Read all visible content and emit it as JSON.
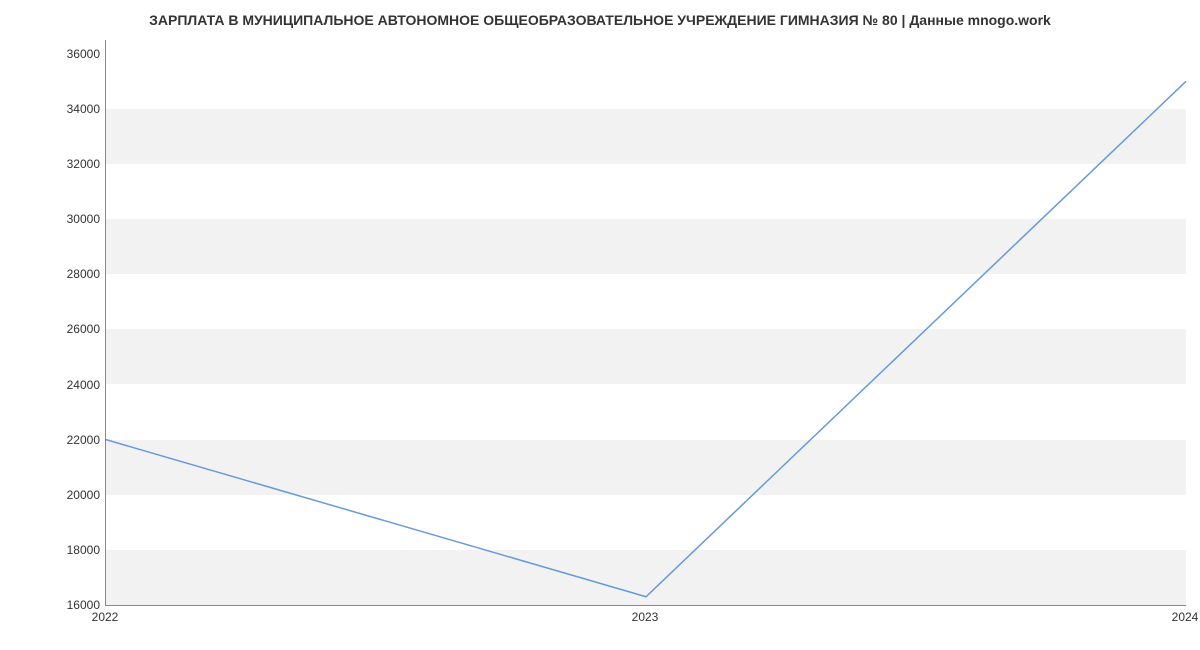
{
  "chart_data": {
    "type": "line",
    "title": "ЗАРПЛАТА В МУНИЦИПАЛЬНОЕ АВТОНОМНОЕ  ОБЩЕОБРАЗОВАТЕЛЬНОЕ УЧРЕЖДЕНИЕ ГИМНАЗИЯ № 80 | Данные mnogo.work",
    "x": [
      2022,
      2023,
      2024
    ],
    "x_labels": [
      "2022",
      "2023",
      "2024"
    ],
    "values": [
      22000,
      16300,
      35000
    ],
    "y_ticks": [
      16000,
      18000,
      20000,
      22000,
      24000,
      26000,
      28000,
      30000,
      32000,
      34000,
      36000
    ],
    "ylim": [
      16000,
      36500
    ],
    "xlim": [
      2022,
      2024
    ],
    "line_color": "#6699dd"
  }
}
